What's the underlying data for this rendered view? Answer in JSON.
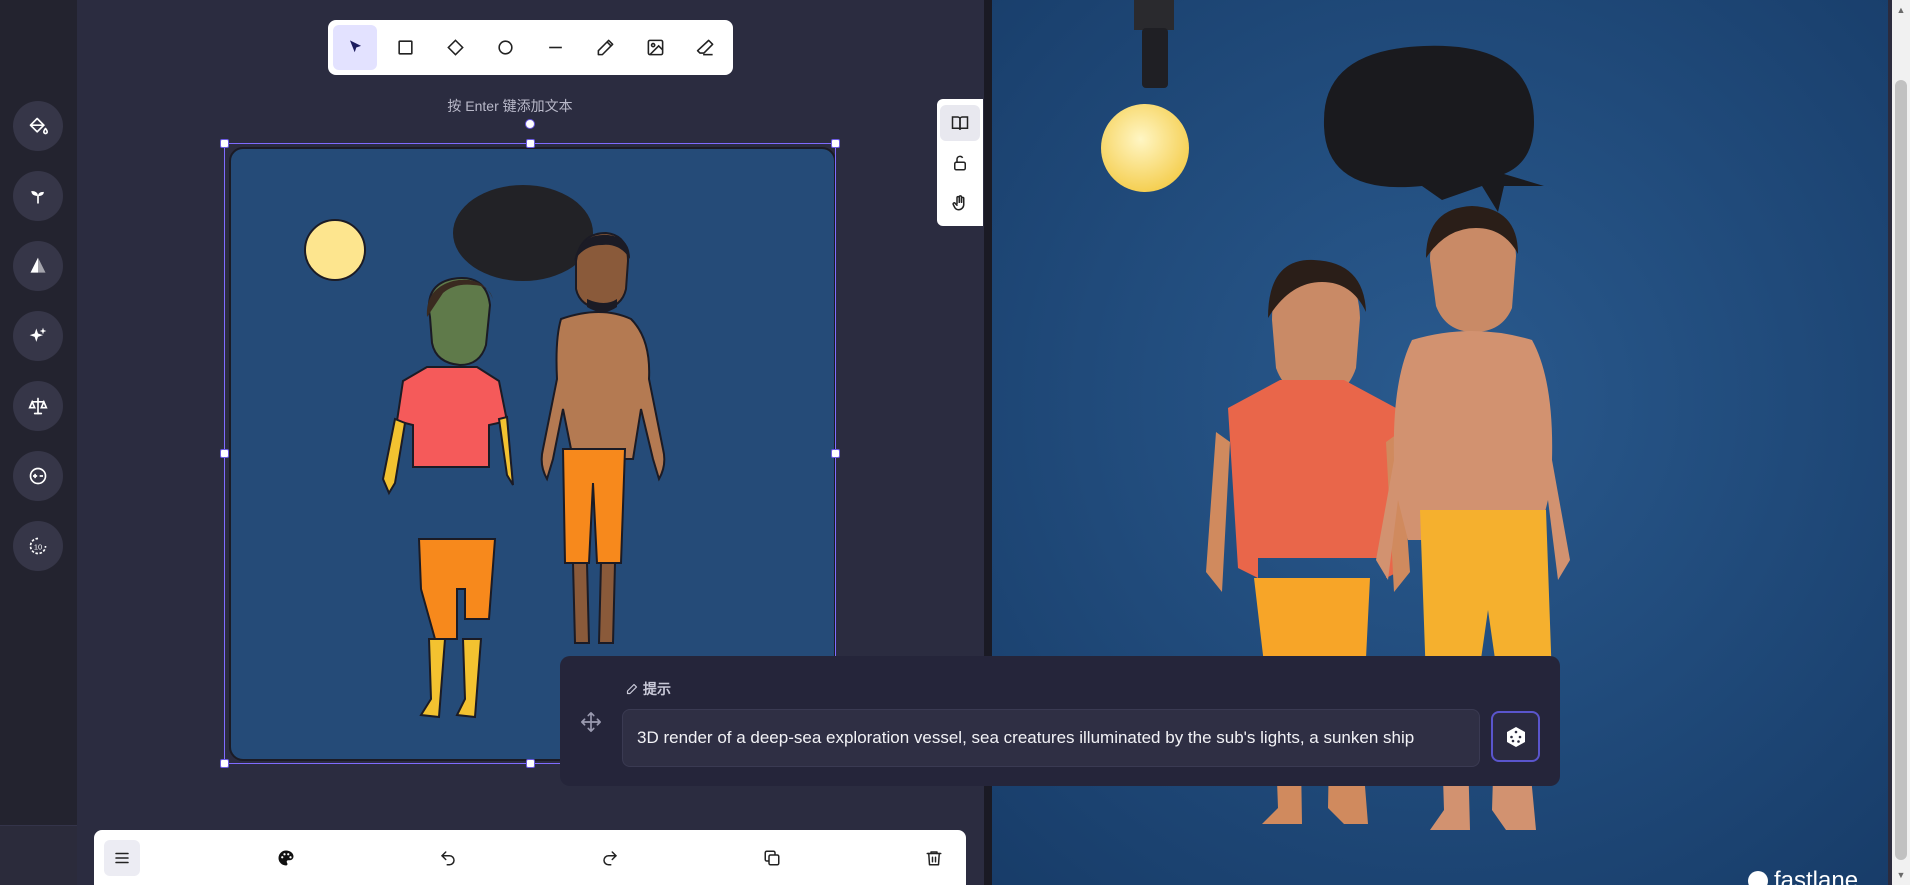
{
  "toolbar": {
    "tools": [
      {
        "icon": "cursor-icon",
        "active": true
      },
      {
        "icon": "rectangle-icon"
      },
      {
        "icon": "diamond-icon"
      },
      {
        "icon": "circle-icon"
      },
      {
        "icon": "line-icon"
      },
      {
        "icon": "pencil-icon"
      },
      {
        "icon": "image-icon"
      },
      {
        "icon": "eraser-icon"
      }
    ]
  },
  "canvas": {
    "hint": "按 Enter 键添加文本",
    "background_color": "#254b78"
  },
  "side_tools": [
    {
      "icon": "book-icon",
      "active": true
    },
    {
      "icon": "unlock-icon"
    },
    {
      "icon": "hand-icon"
    }
  ],
  "rail": [
    {
      "icon": "paint-bucket-icon"
    },
    {
      "icon": "sprout-icon"
    },
    {
      "icon": "pyramid-icon"
    },
    {
      "icon": "sparkles-icon"
    },
    {
      "icon": "scale-icon"
    },
    {
      "icon": "exposure-icon"
    },
    {
      "icon": "timer-10-icon"
    }
  ],
  "prompt": {
    "title": "提示",
    "value": "3D render of a deep-sea exploration vessel, sea creatures illuminated by the sub's lights, a sunken ship"
  },
  "bottom_bar": [
    {
      "icon": "menu-icon"
    },
    {
      "icon": "palette-icon"
    },
    {
      "icon": "undo-icon"
    },
    {
      "icon": "redo-icon"
    },
    {
      "icon": "duplicate-icon"
    },
    {
      "icon": "trash-icon"
    }
  ],
  "brand": {
    "name": "fastlane"
  },
  "colors": {
    "accent": "#6b5be0",
    "canvas_bg": "#2b2c40",
    "rail_bg": "#23232f",
    "frame_bg": "#254b78"
  }
}
